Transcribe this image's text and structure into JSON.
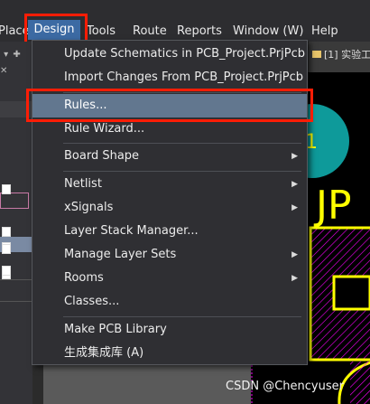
{
  "menubar": {
    "items": [
      "Place",
      "Design",
      "Tools",
      "Route",
      "Reports",
      "Window (W)",
      "Help"
    ]
  },
  "doc_tab": {
    "label": "[1] 实验工"
  },
  "design_menu": {
    "items": [
      {
        "label": "Update Schematics in PCB_Project.PrjPcb"
      },
      {
        "label": "Import Changes From PCB_Project.PrjPcb"
      },
      {
        "label": "Rules...",
        "highlighted": true
      },
      {
        "label": "Rule Wizard..."
      },
      {
        "label": "Board Shape",
        "submenu": true
      },
      {
        "label": "Netlist",
        "submenu": true
      },
      {
        "label": "xSignals",
        "submenu": true
      },
      {
        "label": "Layer Stack Manager..."
      },
      {
        "label": "Manage Layer Sets",
        "submenu": true
      },
      {
        "label": "Rooms",
        "submenu": true
      },
      {
        "label": "Classes..."
      },
      {
        "label": "Make PCB Library"
      },
      {
        "label": "生成集成库 (A)"
      }
    ]
  },
  "pcb": {
    "silk_text": "JP",
    "pad_label": "1"
  },
  "watermark": "CSDN @Chencyuser",
  "colors": {
    "highlight_box": "#ff1d06",
    "menu_selected": "#62778f",
    "pcb_pad": "#0e9a9a",
    "pcb_silk": "#ffff00",
    "pcb_outline": "#ff00ff"
  }
}
